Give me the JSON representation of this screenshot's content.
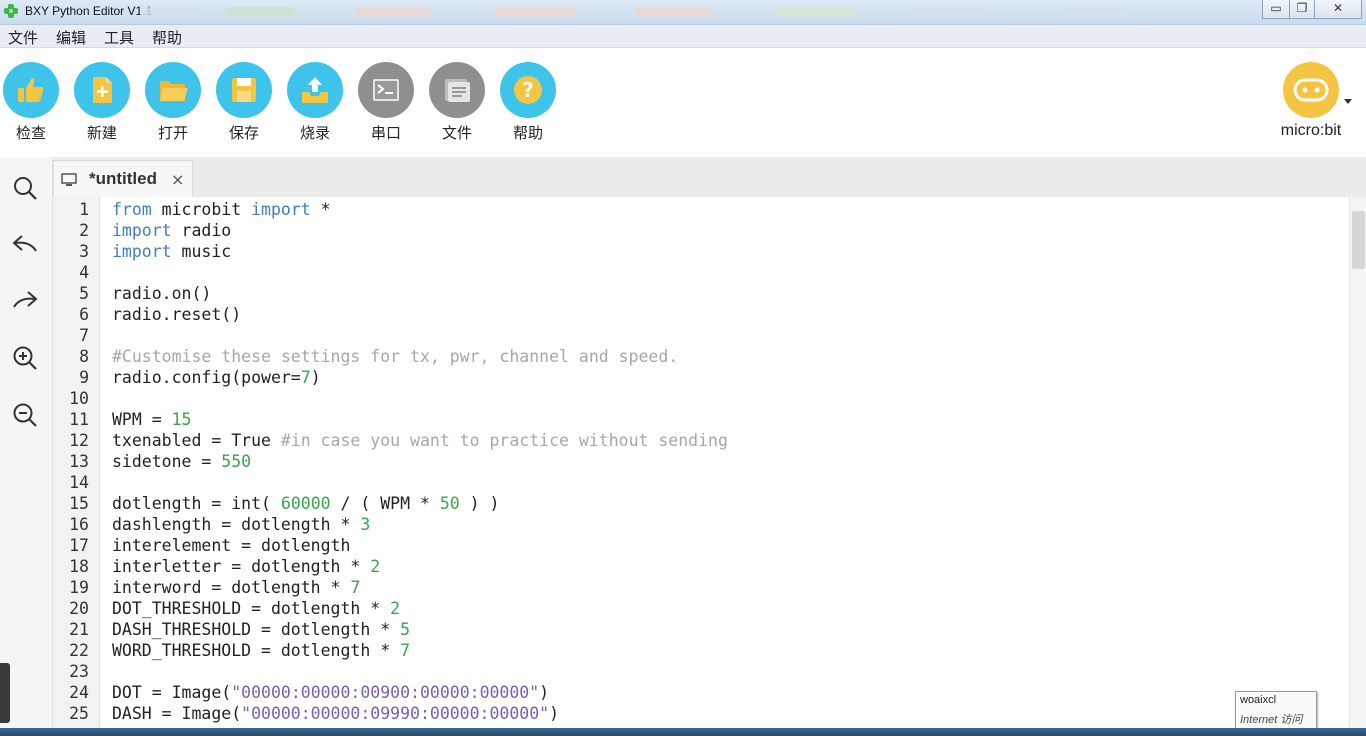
{
  "window": {
    "title": "BXY Python Editor V1.1",
    "minimize_icon": "minimize-icon",
    "restore_icon": "restore-icon",
    "close_icon": "close-icon"
  },
  "menu": {
    "items": [
      "文件",
      "编辑",
      "工具",
      "帮助"
    ]
  },
  "toolbar": {
    "buttons": [
      {
        "label": "检查",
        "icon": "thumbs-up-icon",
        "color": "#3ec3ea"
      },
      {
        "label": "新建",
        "icon": "new-file-icon",
        "color": "#3ec3ea"
      },
      {
        "label": "打开",
        "icon": "open-folder-icon",
        "color": "#3ec3ea"
      },
      {
        "label": "保存",
        "icon": "save-icon",
        "color": "#3ec3ea"
      },
      {
        "label": "烧录",
        "icon": "flash-upload-icon",
        "color": "#3ec3ea"
      },
      {
        "label": "串口",
        "icon": "terminal-icon",
        "color": "#8f8f8f"
      },
      {
        "label": "文件",
        "icon": "files-icon",
        "color": "#8f8f8f"
      },
      {
        "label": "帮助",
        "icon": "help-icon",
        "color": "#f4c542"
      }
    ],
    "device": {
      "label": "micro:bit",
      "icon": "microbit-icon",
      "color": "#f4c542"
    }
  },
  "side_tools": [
    "search-icon",
    "undo-icon",
    "redo-icon",
    "zoom-in-icon",
    "zoom-out-icon"
  ],
  "tab": {
    "title": "*untitled",
    "close": "×",
    "icon": "monitor-icon"
  },
  "editor": {
    "lines": [
      "from microbit import *",
      "import radio",
      "import music",
      "",
      "radio.on()",
      "radio.reset()",
      "",
      "#Customise these settings for tx, pwr, channel and speed.",
      "radio.config(power=7)",
      "",
      "WPM = 15",
      "txenabled = True #in case you want to practice without sending",
      "sidetone = 550",
      "",
      "dotlength = int( 60000 / ( WPM * 50 ) )",
      "dashlength = dotlength * 3",
      "interelement = dotlength",
      "interletter = dotlength * 2",
      "interword = dotlength * 7",
      "DOT_THRESHOLD = dotlength * 2",
      "DASH_THRESHOLD = dotlength * 5",
      "WORD_THRESHOLD = dotlength * 7",
      "",
      "DOT = Image(\"00000:00000:00900:00000:00000\")",
      "DASH = Image(\"00000:00000:09990:00000:00000\")"
    ],
    "colors": {
      "keyword": "#3f7fbf",
      "number": "#3ca24d",
      "comment": "#a7a7a7",
      "string": "#7a5fb0"
    }
  },
  "tooltip": {
    "line1": "woaixcl",
    "line2": "Internet 访问"
  }
}
